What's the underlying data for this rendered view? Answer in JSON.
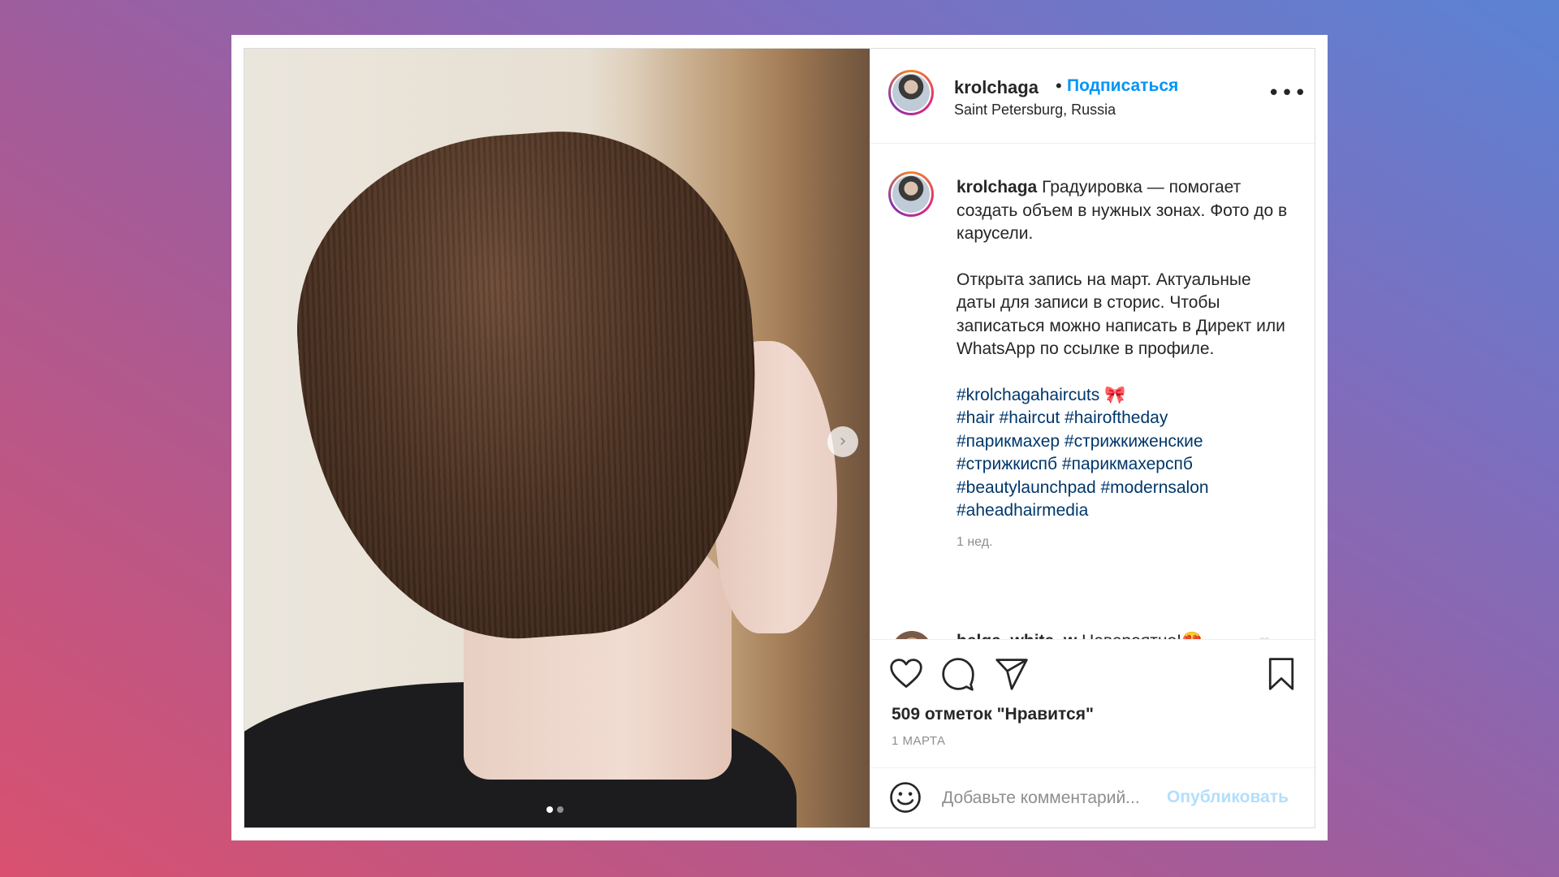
{
  "header": {
    "username": "krolchaga",
    "separator": "•",
    "follow_label": "Подписаться",
    "location": "Saint Petersburg, Russia",
    "more_label": "•••"
  },
  "photo": {
    "next_arrow": "›",
    "carousel_count": 2,
    "carousel_active_index": 0
  },
  "caption": {
    "username": "krolchaga",
    "paragraph1": "Градуировка — помогает создать объем в нужных зонах. Фото до в карусели.",
    "paragraph2": "Открыта запись на март. Актуальные даты для записи в сторис. Чтобы записаться можно написать в Директ или WhatsApp по ссылке в профиле.",
    "hashtags": [
      "#krolchagahaircuts 🎀",
      "#hair #haircut #hairoftheday",
      "#парикмахер #стрижкиженские",
      "#стрижкиспб #парикмахерспб",
      "#beautylaunchpad #modernsalon",
      "#aheadhairmedia"
    ],
    "time": "1 нед."
  },
  "reply": {
    "username": "helga_white_w",
    "text": "Невероятно!😍",
    "heart": "♡"
  },
  "actions": {
    "likes": "509 отметок \"Нравится\"",
    "date": "1 МАРТА"
  },
  "add_comment": {
    "placeholder": "Добавьте комментарий...",
    "publish_label": "Опубликовать"
  },
  "colors": {
    "link_blue": "#0095f6",
    "hashtag": "#00376b",
    "publish_disabled": "#b2dffc",
    "muted": "#8e8e8e"
  },
  "icons": [
    "next-arrow-icon",
    "more-icon",
    "heart-icon",
    "comment-icon",
    "share-icon",
    "bookmark-icon",
    "emoji-icon"
  ]
}
